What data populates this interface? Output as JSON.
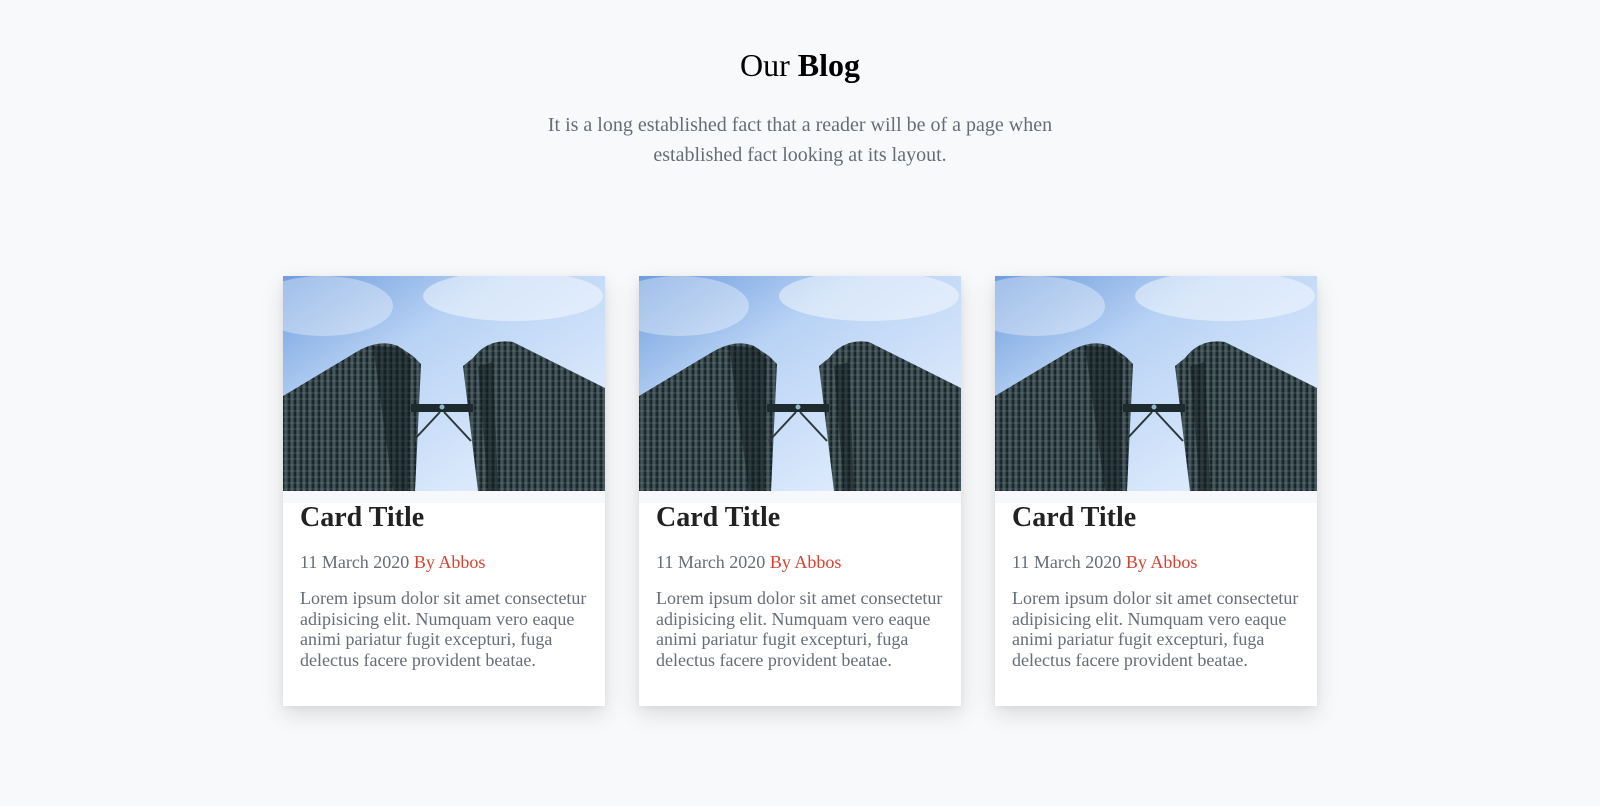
{
  "header": {
    "title_regular": "Our",
    "title_bold": "Blog",
    "subtitle": "It is a long established fact that a reader will be of a page when established fact looking at its layout."
  },
  "colors": {
    "background": "#f8f9fb",
    "text_muted": "#676d75",
    "author_accent": "#d9412e",
    "card_background": "#ffffff"
  },
  "cards": [
    {
      "image_icon": "twin-towers-photo",
      "title": "Card Title",
      "date": "11 March 2020",
      "author": "By Abbos",
      "text": "Lorem ipsum dolor sit amet consectetur adipisicing elit. Numquam vero eaque animi pariatur fugit excepturi, fuga delectus facere provident beatae."
    },
    {
      "image_icon": "twin-towers-photo",
      "title": "Card Title",
      "date": "11 March 2020",
      "author": "By Abbos",
      "text": "Lorem ipsum dolor sit amet consectetur adipisicing elit. Numquam vero eaque animi pariatur fugit excepturi, fuga delectus facere provident beatae."
    },
    {
      "image_icon": "twin-towers-photo",
      "title": "Card Title",
      "date": "11 March 2020",
      "author": "By Abbos",
      "text": "Lorem ipsum dolor sit amet consectetur adipisicing elit. Numquam vero eaque animi pariatur fugit excepturi, fuga delectus facere provident beatae."
    }
  ]
}
